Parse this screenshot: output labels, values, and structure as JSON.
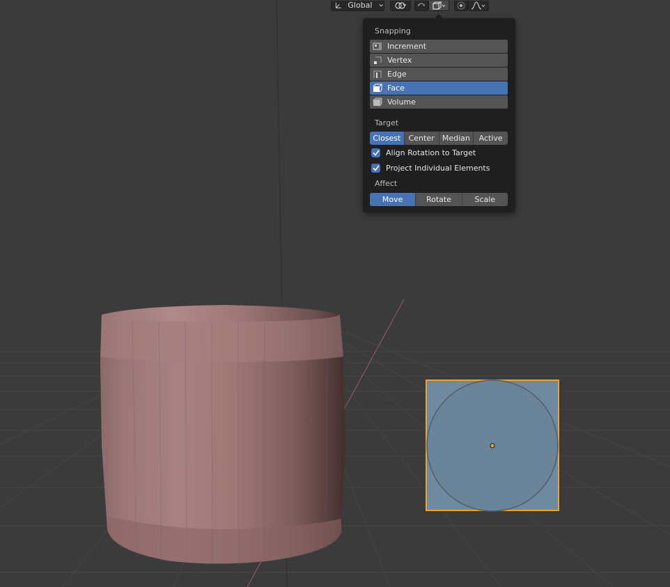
{
  "header": {
    "orientation_label": "Global",
    "orientation_icon": "transform-orientation-icon",
    "pivot_icon": "pivot-point-icon",
    "snap_toggle_icon": "magnet-snap-icon",
    "snap_target_icon": "snap-face-icon",
    "proportional_icon": "proportional-edit-icon",
    "falloff_icon": "falloff-curve-icon"
  },
  "snapping_popup": {
    "section_snapping": "Snapping",
    "snap_items": [
      {
        "label": "Increment",
        "icon": "increment-icon",
        "selected": false
      },
      {
        "label": "Vertex",
        "icon": "vertex-icon",
        "selected": false
      },
      {
        "label": "Edge",
        "icon": "edge-icon",
        "selected": false
      },
      {
        "label": "Face",
        "icon": "face-icon",
        "selected": true
      },
      {
        "label": "Volume",
        "icon": "volume-icon",
        "selected": false
      }
    ],
    "section_target": "Target",
    "target_options": [
      {
        "label": "Closest",
        "selected": true
      },
      {
        "label": "Center",
        "selected": false
      },
      {
        "label": "Median",
        "selected": false
      },
      {
        "label": "Active",
        "selected": false
      }
    ],
    "checkboxes": [
      {
        "label": "Align Rotation to Target",
        "checked": true
      },
      {
        "label": "Project Individual Elements",
        "checked": true
      }
    ],
    "section_affect": "Affect",
    "affect_options": [
      {
        "label": "Move",
        "selected": true
      },
      {
        "label": "Rotate",
        "selected": false
      },
      {
        "label": "Scale",
        "selected": false
      }
    ]
  },
  "colors": {
    "accent": "#4772b3",
    "viewport_bg": "#3b3b3b",
    "selection_outline": "#f0a030",
    "cylinder": "#a07878",
    "plane": "#6f8aa0"
  }
}
